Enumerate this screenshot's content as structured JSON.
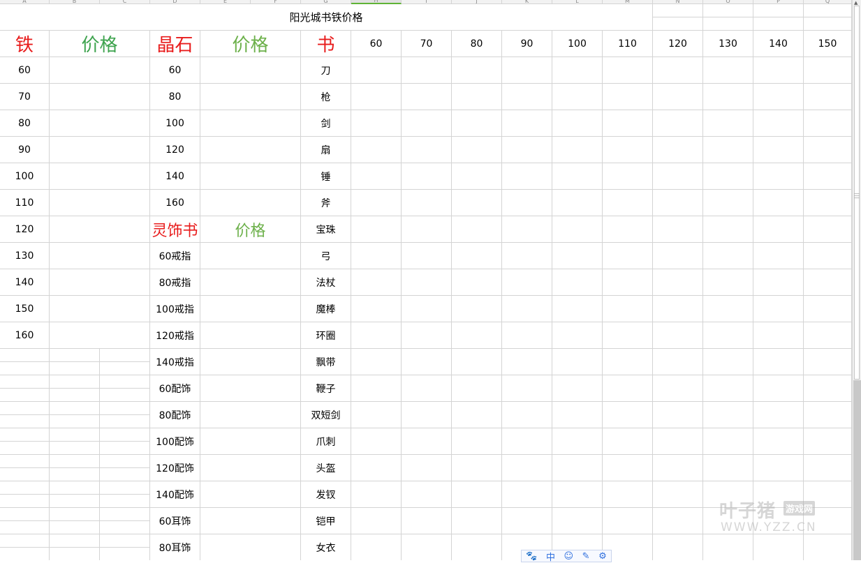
{
  "col_headers": [
    "A",
    "B",
    "C",
    "D",
    "E",
    "F",
    "G",
    "H",
    "I",
    "J",
    "K",
    "L",
    "M",
    "N",
    "O",
    "P",
    "Q"
  ],
  "active_column": "H",
  "title": "阳光城书铁价格",
  "headers": {
    "iron": "铁",
    "price1": "价格",
    "crystal": "晶石",
    "price2": "价格",
    "book": "书",
    "levels": [
      "60",
      "70",
      "80",
      "90",
      "100",
      "110",
      "120",
      "130",
      "140",
      "150"
    ]
  },
  "iron_levels": [
    "60",
    "70",
    "80",
    "90",
    "100",
    "110",
    "120",
    "130",
    "140",
    "150",
    "160"
  ],
  "crystal_levels": [
    "60",
    "80",
    "100",
    "120",
    "140",
    "160"
  ],
  "spirit_book": "灵饰书",
  "spirit_price": "价格",
  "spirit_items": [
    "60戒指",
    "80戒指",
    "100戒指",
    "120戒指",
    "140戒指",
    "60配饰",
    "80配饰",
    "100配饰",
    "120配饰",
    "140配饰",
    "60耳饰",
    "80耳饰"
  ],
  "books": [
    "刀",
    "枪",
    "剑",
    "扇",
    "锤",
    "斧",
    "宝珠",
    "弓",
    "法杖",
    "魔棒",
    "环圈",
    "飘带",
    "鞭子",
    "双短剑",
    "爪刺",
    "头盔",
    "发钗",
    "铠甲",
    "女衣"
  ],
  "ime_icons": [
    "paw-icon",
    "chinese-mode-icon",
    "emoji-icon",
    "pen-icon",
    "settings-icon"
  ],
  "ime_glyphs": [
    "🐾",
    "中",
    "☺",
    "✎",
    "⚙"
  ],
  "watermark": {
    "main": "叶子猪",
    "badge": "游戏网",
    "url": "WWW.YZZ.CN"
  }
}
